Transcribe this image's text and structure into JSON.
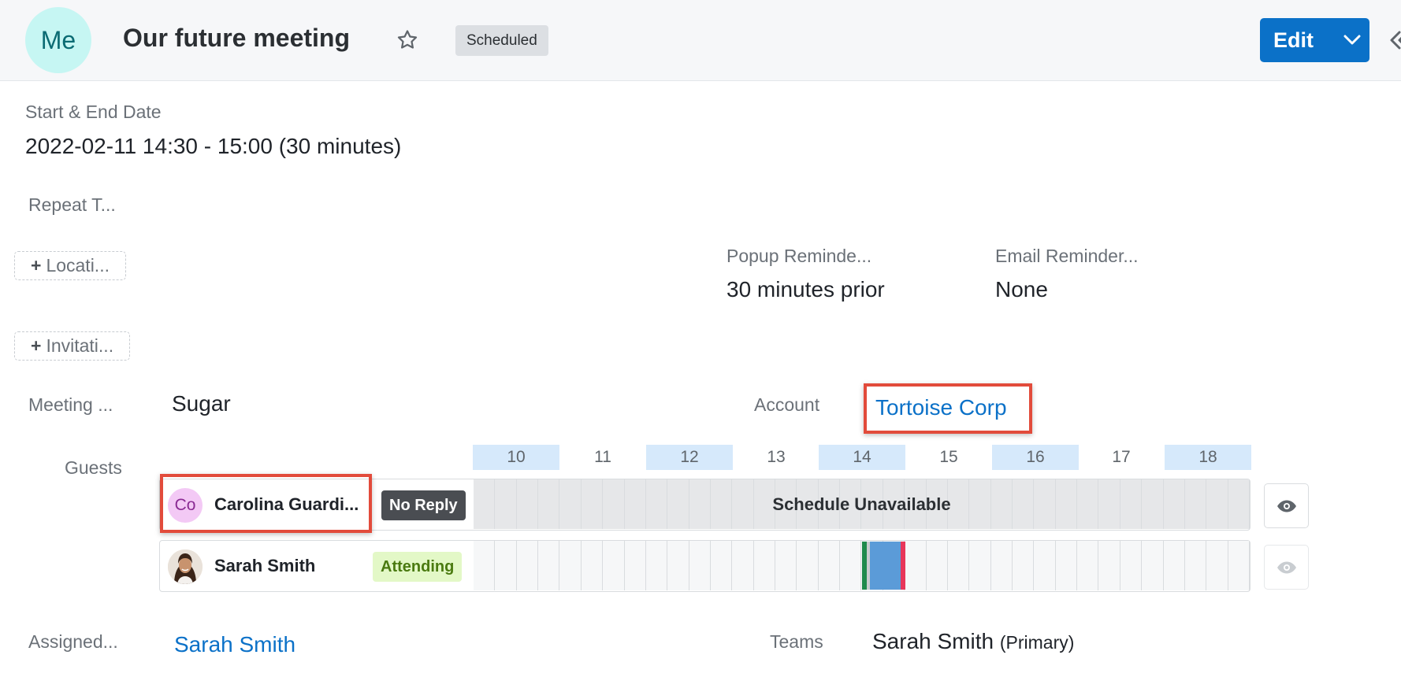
{
  "header": {
    "avatar_initials": "Me",
    "title": "Our future meeting",
    "status": "Scheduled",
    "edit_label": "Edit"
  },
  "fields": {
    "start_end_label": "Start & End Date",
    "start_end_value": "2022-02-11 14:30 - 15:00 (30 minutes)",
    "repeat_label": "Repeat T...",
    "location_pill": "Locati...",
    "invitation_pill": "Invitati...",
    "popup_label": "Popup Reminde...",
    "popup_value": "30 minutes prior",
    "email_label": "Email Reminder...",
    "email_value": "None",
    "meeting_label": "Meeting ...",
    "meeting_value": "Sugar",
    "account_label": "Account",
    "account_value": "Tortoise Corp",
    "guests_label": "Guests",
    "assigned_label": "Assigned...",
    "assigned_value": "Sarah Smith",
    "teams_label": "Teams",
    "teams_value": "Sarah Smith",
    "teams_primary": "(Primary)"
  },
  "timeline": {
    "hours": [
      "10",
      "11",
      "12",
      "13",
      "14",
      "15",
      "16",
      "17",
      "18"
    ],
    "unavailable_text": "Schedule Unavailable"
  },
  "guests": [
    {
      "initials": "Co",
      "name": "Carolina Guardi...",
      "status": "No Reply"
    },
    {
      "initials": "",
      "name": "Sarah Smith",
      "status": "Attending"
    }
  ],
  "colors": {
    "accent": "#0b71c8",
    "highlight": "#e24b3b",
    "attending_bg": "#e3f8c7",
    "attending_text": "#4a7a10",
    "no_reply_bg": "#4a4d52",
    "meeting_block": "#5b9bd8"
  }
}
